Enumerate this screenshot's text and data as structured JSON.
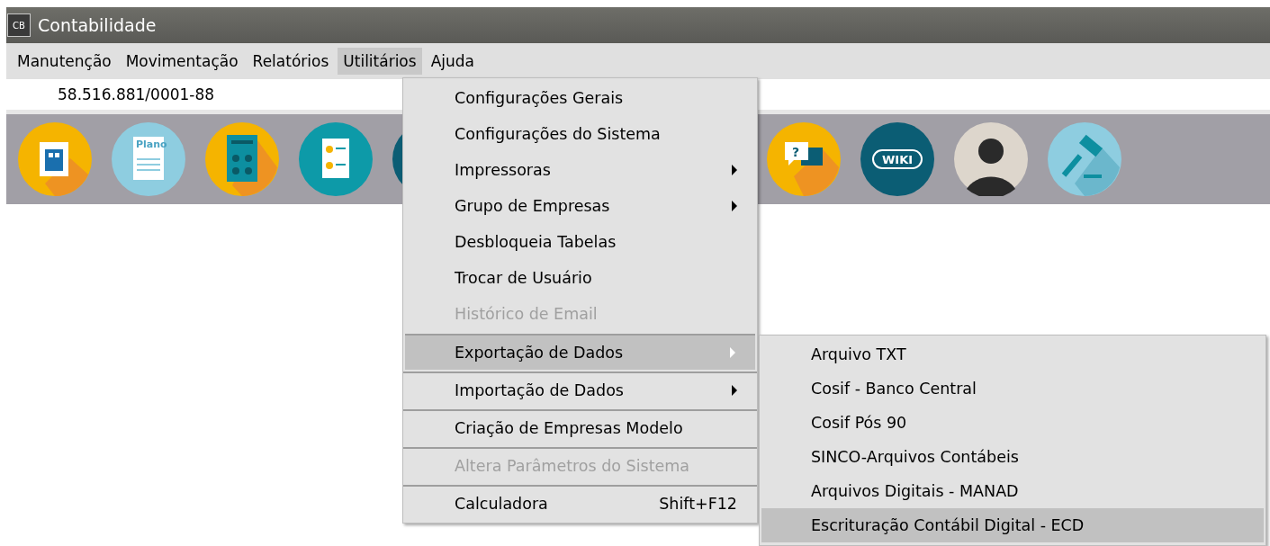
{
  "window": {
    "title": "Contabilidade",
    "app_badge": "CB"
  },
  "menu_bar": [
    {
      "label": "Manutenção",
      "selected": false
    },
    {
      "label": "Movimentação",
      "selected": false
    },
    {
      "label": "Relatórios",
      "selected": false
    },
    {
      "label": "Utilitários",
      "selected": true
    },
    {
      "label": "Ajuda",
      "selected": false
    }
  ],
  "company_id": "58.516.881/0001-88",
  "toolbar": [
    {
      "kind": "building"
    },
    {
      "kind": "plan",
      "caption": "Plano"
    },
    {
      "kind": "calculator"
    },
    {
      "kind": "report"
    },
    {
      "kind": "partial"
    },
    {
      "kind": "hidden"
    },
    {
      "kind": "hidden"
    },
    {
      "kind": "hidden"
    },
    {
      "kind": "help",
      "caption": "?"
    },
    {
      "kind": "wiki",
      "caption": "WIKI"
    },
    {
      "kind": "avatar"
    },
    {
      "kind": "gavel"
    }
  ],
  "menu": [
    {
      "label": "Configurações Gerais",
      "disabled": false,
      "selected": false,
      "submenu": false,
      "separator_before": false
    },
    {
      "label": "Configurações do Sistema",
      "disabled": false,
      "selected": false,
      "submenu": false,
      "separator_before": false
    },
    {
      "label": "Impressoras",
      "disabled": false,
      "selected": false,
      "submenu": true,
      "separator_before": false
    },
    {
      "label": "Grupo de Empresas",
      "disabled": false,
      "selected": false,
      "submenu": true,
      "separator_before": false
    },
    {
      "label": "Desbloqueia Tabelas",
      "disabled": false,
      "selected": false,
      "submenu": false,
      "separator_before": false
    },
    {
      "label": "Trocar de Usuário",
      "disabled": false,
      "selected": false,
      "submenu": false,
      "separator_before": false
    },
    {
      "label": "Histórico de Email",
      "disabled": true,
      "selected": false,
      "submenu": false,
      "separator_before": false
    },
    {
      "label": "Exportação de Dados",
      "disabled": false,
      "selected": true,
      "submenu": true,
      "separator_before": true
    },
    {
      "label": "Importação de Dados",
      "disabled": false,
      "selected": false,
      "submenu": true,
      "separator_before": true
    },
    {
      "label": "Criação de Empresas Modelo",
      "disabled": false,
      "selected": false,
      "submenu": false,
      "separator_before": true
    },
    {
      "label": "Altera Parâmetros do Sistema",
      "disabled": true,
      "selected": false,
      "submenu": false,
      "separator_before": true
    },
    {
      "label": "Calculadora",
      "shortcut": "Shift+F12",
      "disabled": false,
      "selected": false,
      "submenu": false,
      "separator_before": true
    }
  ],
  "submenu": [
    {
      "label": "Arquivo TXT",
      "selected": false
    },
    {
      "label": "Cosif - Banco Central",
      "selected": false
    },
    {
      "label": "Cosif Pós 90",
      "selected": false
    },
    {
      "label": "SINCO-Arquivos Contábeis",
      "selected": false
    },
    {
      "label": "Arquivos Digitais - MANAD",
      "selected": false
    },
    {
      "label": "Escrituração Contábil Digital - ECD",
      "selected": true
    }
  ]
}
